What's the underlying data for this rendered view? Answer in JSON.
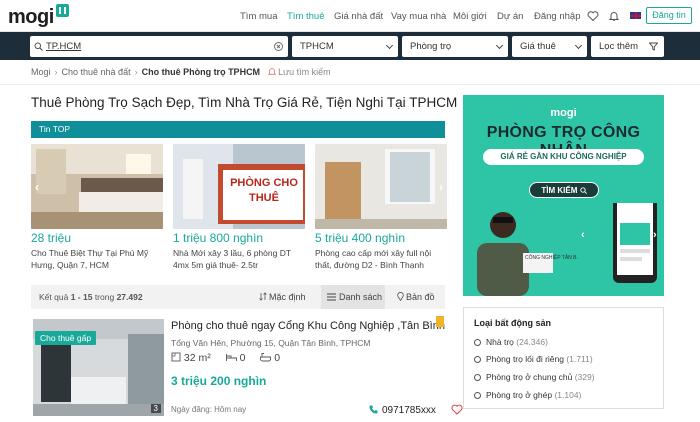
{
  "header": {
    "logo": "mogi",
    "nav": [
      "Tìm mua",
      "Tìm thuê",
      "Giá nhà đất",
      "Vay mua nhà",
      "Môi giới",
      "Dự án",
      "Đăng nhập"
    ],
    "post_button": "Đăng tin",
    "accent": "#18a99a"
  },
  "search": {
    "query": "TP.HCM",
    "city": "TPHCM",
    "type": "Phòng trọ",
    "price": "Giá thuê",
    "filter": "Lọc thêm"
  },
  "breadcrumb": {
    "items": [
      "Mogi",
      "Cho thuê nhà đất",
      "Cho thuê Phòng trọ TPHCM"
    ],
    "save": "Lưu tìm kiếm"
  },
  "page_title": "Thuê Phòng Trọ Sạch Đẹp, Tìm Nhà Trọ Giá Rẻ, Tiện Nghi Tại TPHCM",
  "top_label": "Tin TOP",
  "top_cards": [
    {
      "price": "28 triệu",
      "desc": "Cho Thuê Biệt Thự Tại Phú Mỹ Hưng, Quận 7, HCM"
    },
    {
      "price": "1 triệu 800 nghìn",
      "desc": "Nhà Mới xây 3 lầu, 6 phòng DT 4mx 5m giá thuê- 2.5tr",
      "sign": "PHÒNG CHO THUÊ"
    },
    {
      "price": "5 triệu 400 nghìn",
      "desc": "Phòng cao cấp mới xây full nội thất, đường D2 - Bình Thạnh"
    }
  ],
  "results": {
    "count_text": "Kết quả",
    "range": "1 - 15",
    "trong": "trong",
    "total": "27.492",
    "buttons": [
      "Mặc định",
      "Danh sách",
      "Bản đồ"
    ]
  },
  "listing": {
    "tag": "Cho thuê gấp",
    "title": "Phòng cho thuê ngay Cổng Khu Công Nghiệp ,Tân Bình",
    "address": "Tổng Văn Hên, Phường 15, Quận Tân Bình, TPHCM",
    "area": "32 m²",
    "beds": "0",
    "baths": "0",
    "price": "3 triệu 200 nghìn",
    "date": "Ngày đăng: Hôm nay",
    "phone": "0971785xxx",
    "photo_count": "3"
  },
  "ad": {
    "logo": "mogi",
    "headline": "PHÒNG TRỌ CÔNG NHÂN",
    "sub": "GIÁ RẺ GẦN KHU CÔNG NGHIỆP",
    "button": "TÌM KIẾM",
    "sign": "CÔNG NGHIỆP TÂN B."
  },
  "types": {
    "heading": "Loại bất động sản",
    "items": [
      {
        "label": "Nhà trọ",
        "count": "(24.346)"
      },
      {
        "label": "Phòng trọ lối đi riêng",
        "count": "(1.711)"
      },
      {
        "label": "Phòng trọ ở chung chủ",
        "count": "(329)"
      },
      {
        "label": "Phòng trọ ở ghép",
        "count": "(1.104)"
      }
    ]
  }
}
